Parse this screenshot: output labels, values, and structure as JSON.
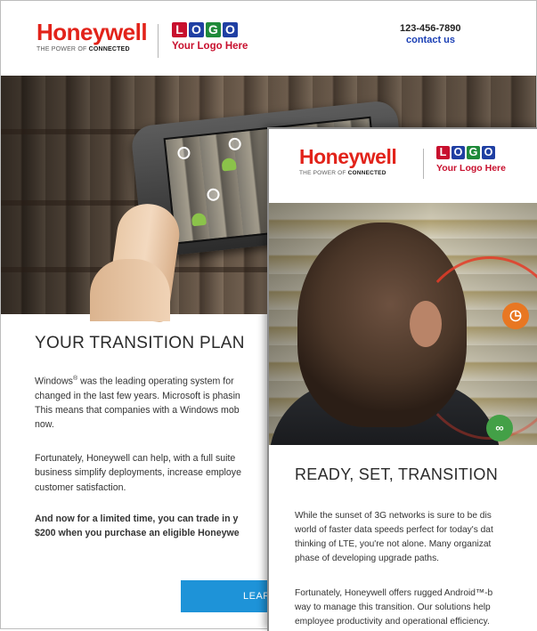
{
  "brand": {
    "name": "Honeywell",
    "tagline_prefix": "THE POWER OF",
    "tagline_bold": "CONNECTED",
    "logo_letters": [
      "L",
      "O",
      "G",
      "O"
    ],
    "logo_colors": [
      "#c8102e",
      "#1f3fa3",
      "#1f8a3a",
      "#1f3fa3"
    ],
    "logo_caption": "Your Logo Here",
    "red": "#e2231a"
  },
  "header": {
    "phone": "123-456-7890",
    "contact_link": "contact us"
  },
  "email_back": {
    "headline": "YOUR TRANSITION PLAN",
    "paragraph_1": [
      "Windows",
      " was the leading operating system for",
      "changed in the last few years. Microsoft is phasin",
      "This means that companies with a Windows mob",
      "now."
    ],
    "registered_mark": "®",
    "paragraph_2": [
      "Fortunately, Honeywell can help, with a full suite",
      "business simplify deployments, increase employe",
      "customer satisfaction."
    ],
    "paragraph_3": [
      "And now for a limited time, you can trade in y",
      "$200 when you purchase an eligible Honeywe"
    ],
    "cta_label": "LEAR",
    "cta_color": "#1e93d8"
  },
  "email_front": {
    "headline": "READY, SET, TRANSITION",
    "paragraph_1": [
      "While the sunset of 3G networks is sure to be dis",
      "world of faster data speeds perfect for today's dat",
      "thinking of LTE, you're not alone. Many organizat",
      "phase of developing upgrade paths."
    ],
    "paragraph_2": [
      "Fortunately, Honeywell offers rugged Android™-b",
      "way to manage this transition. Our solutions help",
      "employee productivity and operational efficiency."
    ]
  }
}
